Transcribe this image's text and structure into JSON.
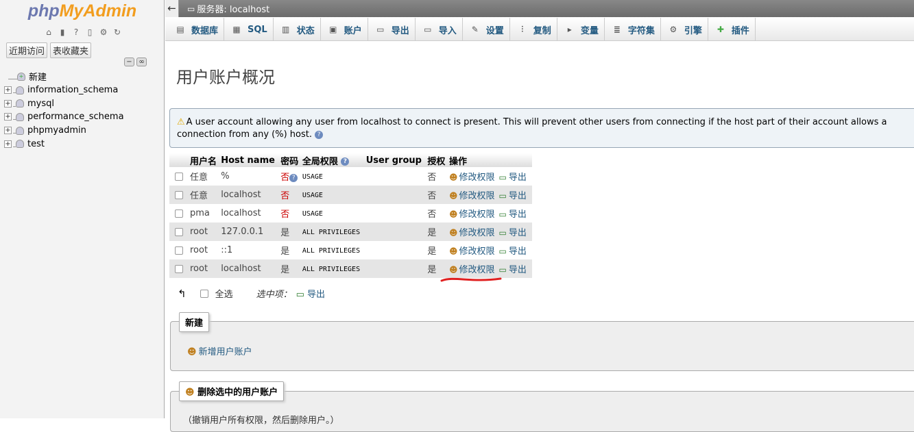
{
  "nav": {
    "logo_php": "php",
    "logo_myadmin": "MyAdmin",
    "icons": [
      "home-icon",
      "logout-icon",
      "help-icon",
      "docs-icon",
      "settings-icon",
      "reload-icon"
    ],
    "recent_label": "近期访问",
    "favorites_label": "表收藏夹",
    "collapse_label": "−",
    "link_label": "∞",
    "new_label": "新建",
    "databases": [
      "information_schema",
      "mysql",
      "performance_schema",
      "phpmyadmin",
      "test"
    ]
  },
  "topbar": {
    "back": "←",
    "server": "服务器: localhost"
  },
  "tabs": [
    {
      "label": "数据库",
      "icon": "database-icon",
      "glyph": "▤"
    },
    {
      "label": "SQL",
      "icon": "sql-icon",
      "glyph": "▦"
    },
    {
      "label": "状态",
      "icon": "status-icon",
      "glyph": "▥"
    },
    {
      "label": "账户",
      "icon": "accounts-icon",
      "glyph": "▣"
    },
    {
      "label": "导出",
      "icon": "export-icon",
      "glyph": "▭"
    },
    {
      "label": "导入",
      "icon": "import-icon",
      "glyph": "▭"
    },
    {
      "label": "设置",
      "icon": "wrench-icon",
      "glyph": "✎"
    },
    {
      "label": "复制",
      "icon": "replication-icon",
      "glyph": "⫶"
    },
    {
      "label": "变量",
      "icon": "variables-icon",
      "glyph": "▸"
    },
    {
      "label": "字符集",
      "icon": "charset-icon",
      "glyph": "≣"
    },
    {
      "label": "引擎",
      "icon": "engine-icon",
      "glyph": "⚙"
    },
    {
      "label": "插件",
      "icon": "plugin-icon",
      "glyph": "✚"
    }
  ],
  "main": {
    "title": "用户账户概况",
    "notice": "A user account allowing any user from localhost to connect is present. This will prevent other users from connecting if the host part of their account allows a connection from any (%) host.",
    "table": {
      "headers": {
        "user": "用户名",
        "host": "Host name",
        "password": "密码",
        "privileges": "全局权限",
        "group": "User group",
        "grant": "授权",
        "action": "操作"
      },
      "rows": [
        {
          "user": "任意",
          "user_red": true,
          "host": "%",
          "password": "否",
          "pw_red": true,
          "pw_help": true,
          "privileges": "USAGE",
          "grant": "否"
        },
        {
          "user": "任意",
          "user_red": true,
          "host": "localhost",
          "password": "否",
          "pw_red": true,
          "pw_help": false,
          "privileges": "USAGE",
          "grant": "否"
        },
        {
          "user": "pma",
          "user_red": false,
          "host": "localhost",
          "password": "否",
          "pw_red": true,
          "pw_help": false,
          "privileges": "USAGE",
          "grant": "否"
        },
        {
          "user": "root",
          "user_red": false,
          "host": "127.0.0.1",
          "password": "是",
          "pw_red": false,
          "pw_help": false,
          "privileges": "ALL PRIVILEGES",
          "grant": "是"
        },
        {
          "user": "root",
          "user_red": false,
          "host": "::1",
          "password": "是",
          "pw_red": false,
          "pw_help": false,
          "privileges": "ALL PRIVILEGES",
          "grant": "是"
        },
        {
          "user": "root",
          "user_red": false,
          "host": "localhost",
          "password": "是",
          "pw_red": false,
          "pw_help": false,
          "privileges": "ALL PRIVILEGES",
          "grant": "是"
        }
      ],
      "edit_label": "修改权限",
      "export_label": "导出"
    },
    "select_all": "全选",
    "with_selected": "选中项：",
    "export_selected": "导出",
    "new_legend": "新建",
    "add_user": "新增用户账户",
    "delete_legend": "删除选中的用户账户",
    "delete_note": "（撤销用户所有权限，然后删除用户。）"
  },
  "colors": {
    "link": "#235a81",
    "red": "#cc0000",
    "annotation": "#e02020"
  }
}
